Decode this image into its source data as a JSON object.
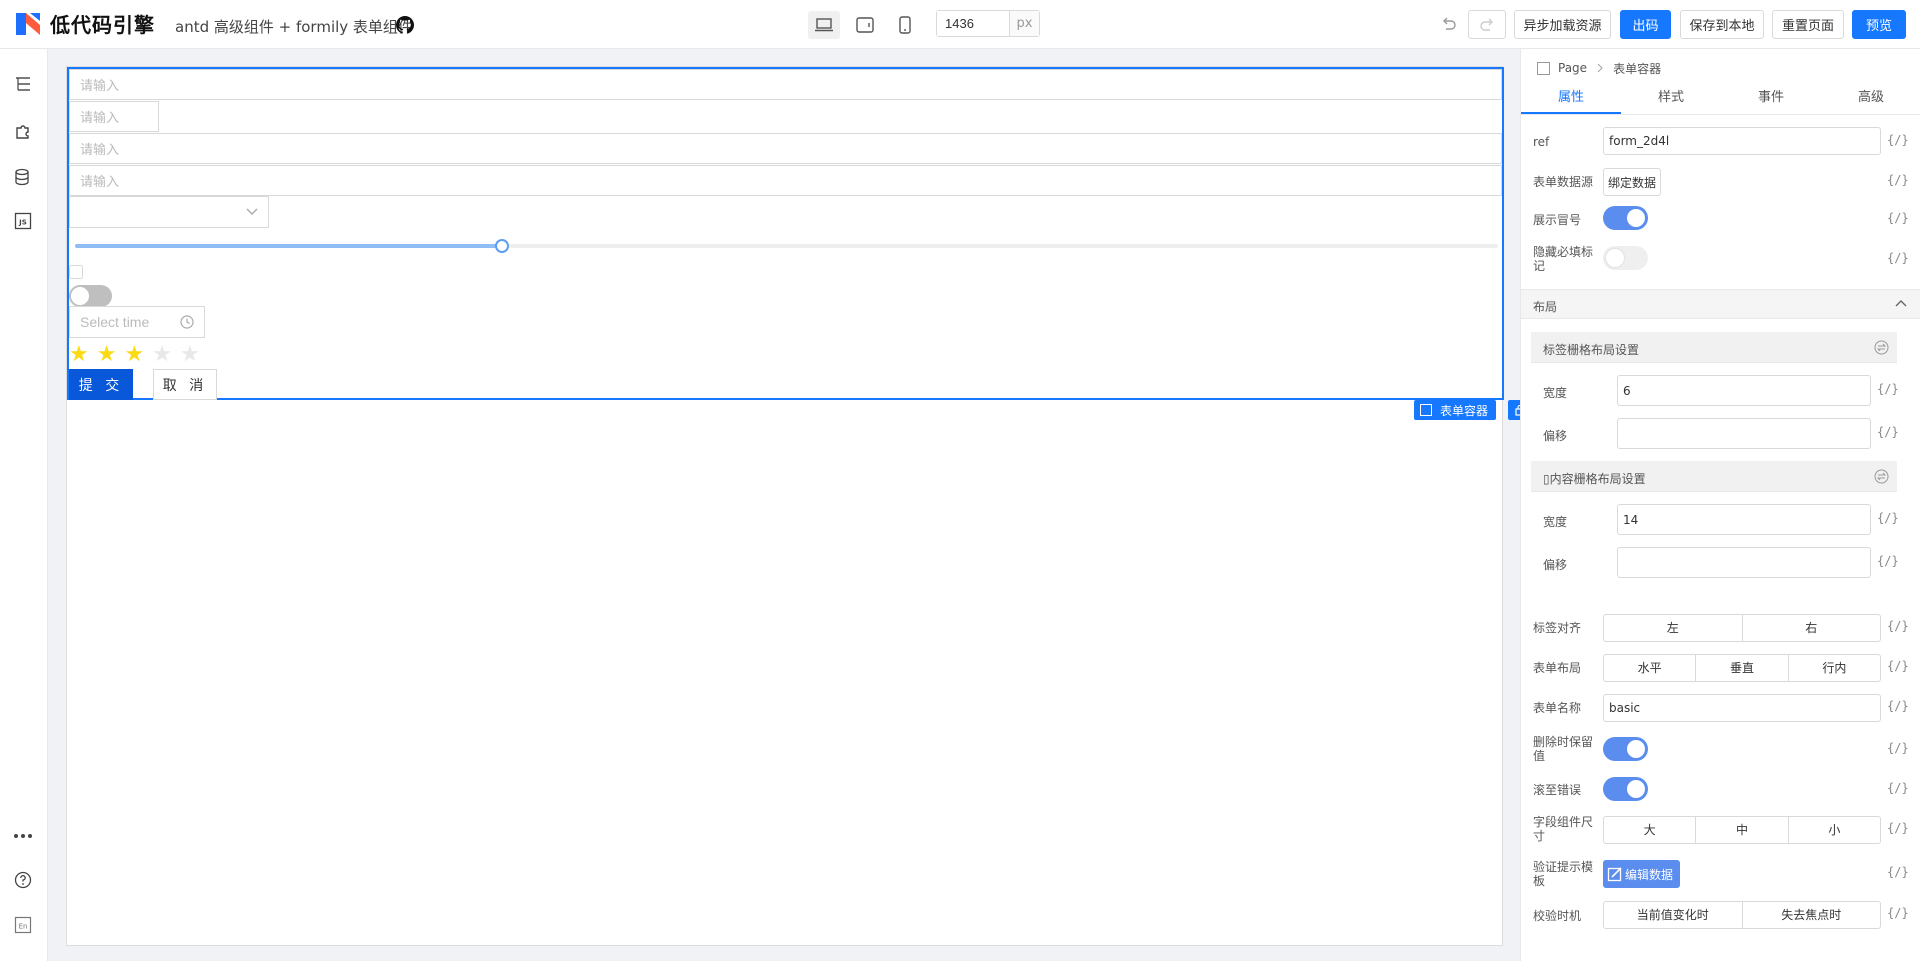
{
  "header": {
    "brand": "低代码引擎",
    "subtitle": "antd 高级组件 + formily 表单组件",
    "width_value": "1436",
    "width_unit": "px",
    "buttons": {
      "async_load": "异步加载资源",
      "export": "出码",
      "save_local": "保存到本地",
      "reset": "重置页面",
      "preview": "预览"
    },
    "accent": "#1677ff"
  },
  "canvas": {
    "inputs": [
      "请输入",
      "请输入",
      "请输入",
      "请输入"
    ],
    "time_placeholder": "Select time",
    "slider_value_fraction": 0.3,
    "rating": {
      "value": 3,
      "max": 5
    },
    "submit_label": "提 交",
    "cancel_label": "取 消",
    "selected_label": "表单容器"
  },
  "panel": {
    "breadcrumb": {
      "root": "Page",
      "current": "表单容器"
    },
    "tabs": [
      "属性",
      "样式",
      "事件",
      "高级"
    ],
    "props": {
      "ref_label": "ref",
      "ref_value": "form_2d4l",
      "datasource_label": "表单数据源",
      "bind_data": "绑定数据",
      "show_colon_label": "展示冒号",
      "hide_required_label": "隐藏必填标记",
      "code_symbol": "{/}"
    },
    "layout": {
      "title": "布局",
      "label_grid_title": "标签栅格布局设置",
      "content_grid_title": "内容栅格布局设置",
      "content_grid_prefix": "▯",
      "width_label": "宽度",
      "offset_label": "偏移",
      "label_width": "6",
      "label_offset": "",
      "content_width": "14",
      "content_offset": ""
    },
    "misc": {
      "label_align_label": "标签对齐",
      "label_align_options": [
        "左",
        "右"
      ],
      "form_layout_label": "表单布局",
      "form_layout_options": [
        "水平",
        "垂直",
        "行内"
      ],
      "form_name_label": "表单名称",
      "form_name_value": "basic",
      "preserve_label": "删除时保留值",
      "scroll_error_label": "滚至错误",
      "size_label": "字段组件尺寸",
      "size_options": [
        "大",
        "中",
        "小"
      ],
      "validate_template_label": "验证提示模板",
      "edit_data": "编辑数据",
      "validate_trigger_label": "校验时机",
      "validate_trigger_options": [
        "当前值变化时",
        "失去焦点时"
      ]
    }
  }
}
